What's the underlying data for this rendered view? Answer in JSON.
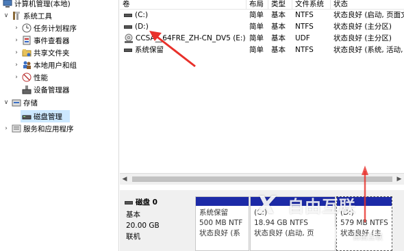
{
  "tree": {
    "root": "计算机管理(本地)",
    "system_tools": "系统工具",
    "task_scheduler": "任务计划程序",
    "event_viewer": "事件查看器",
    "shared_folders": "共享文件夹",
    "local_users": "本地用户和组",
    "performance": "性能",
    "device_manager": "设备管理器",
    "storage": "存储",
    "disk_management": "磁盘管理",
    "services": "服务和应用程序"
  },
  "volumes": {
    "headers": [
      "卷",
      "布局",
      "类型",
      "文件系统",
      "状态"
    ],
    "rows": [
      {
        "name": "(C:)",
        "layout": "简单",
        "type": "基本",
        "fs": "NTFS",
        "status": "状态良好 (启动, 页面文"
      },
      {
        "name": "(D:)",
        "layout": "简单",
        "type": "基本",
        "fs": "NTFS",
        "status": "状态良好 (主分区)"
      },
      {
        "name": "CCSA__64FRE_ZH-CN_DV5 (E:)",
        "layout": "简单",
        "type": "基本",
        "fs": "UDF",
        "status": "状态良好 (主分区)"
      },
      {
        "name": "系统保留",
        "layout": "简单",
        "type": "基本",
        "fs": "NTFS",
        "status": "状态良好 (系统, 活动, 主"
      }
    ]
  },
  "disk": {
    "title": "磁盘 0",
    "type": "基本",
    "size": "20.00 GB",
    "state": "联机",
    "partitions": [
      {
        "name": "系统保留",
        "size": "500 MB NTF",
        "status": "状态良好 (系"
      },
      {
        "name": "(C:)",
        "size": "18.94 GB NTFS",
        "status": "状态良好 (启动, 页"
      },
      {
        "name": "(D:)",
        "size": "579 MB NTFS",
        "status": "状态良好 (主"
      }
    ]
  },
  "watermark": {
    "text": "自由互联",
    "sub": "自由互联"
  },
  "colors": {
    "partition_bar": "#1c2aa7",
    "selection": "#cce8ff",
    "annotation_arrow": "#e8302a"
  }
}
